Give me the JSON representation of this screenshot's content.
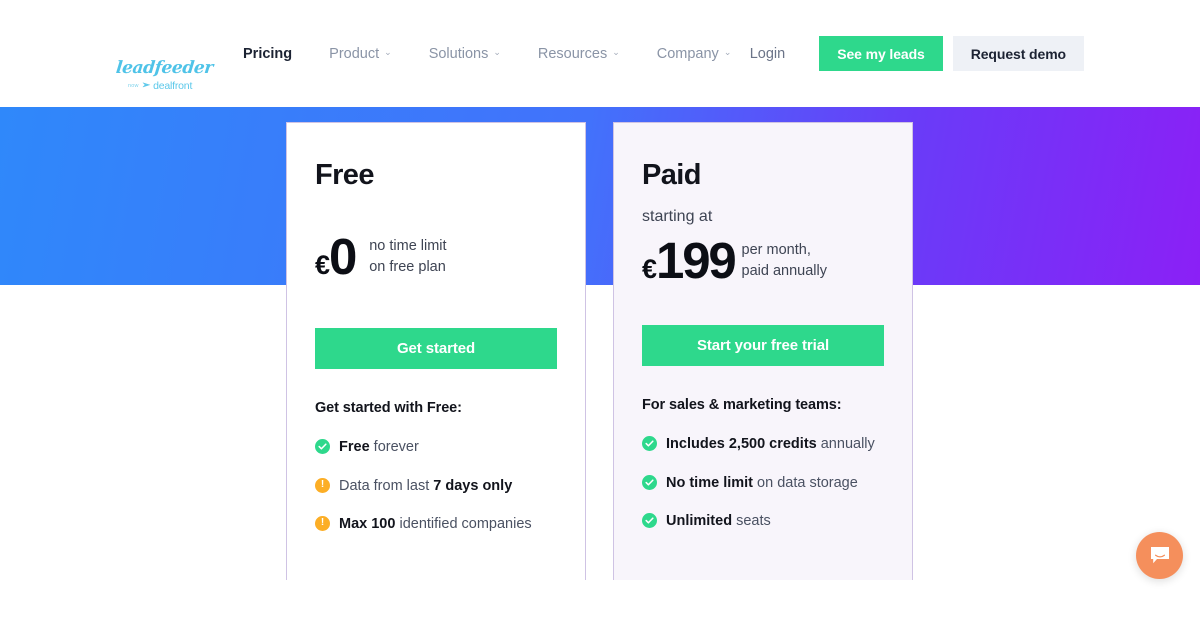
{
  "brand": {
    "logo_word": "leadfeeder",
    "logo_now": "now",
    "logo_mark": "➢",
    "logo_dealfront": "dealfront",
    "green": "#2ED88C",
    "orange": "#FCAE26",
    "gradient_from": "#2F88FA",
    "gradient_to": "#8B20F6",
    "chat_color": "#F58F5C"
  },
  "header": {
    "nav": [
      {
        "label": "Pricing",
        "has_caret": false,
        "active": true
      },
      {
        "label": "Product",
        "has_caret": true,
        "active": false
      },
      {
        "label": "Solutions",
        "has_caret": true,
        "active": false
      },
      {
        "label": "Resources",
        "has_caret": true,
        "active": false
      },
      {
        "label": "Company",
        "has_caret": true,
        "active": false
      }
    ],
    "login_label": "Login",
    "cta_primary": "See my leads",
    "cta_secondary": "Request demo",
    "caret_glyph": "⌄"
  },
  "plans": [
    {
      "id": "free",
      "title": "Free",
      "starting_at": "",
      "currency": "€",
      "amount": "0",
      "note_line1": "no time limit",
      "note_line2": "on free plan",
      "cta": "Get started",
      "list_heading": "Get started with Free:",
      "features": [
        {
          "icon": "check-circle-icon",
          "bold": "Free",
          "rest": " forever",
          "bold_first": true
        },
        {
          "icon": "warning-circle-icon",
          "lead": "Data from last ",
          "bold": "7 days only",
          "bold_first": false
        },
        {
          "icon": "warning-circle-icon",
          "bold": "Max 100",
          "rest": " identified companies",
          "bold_first": true
        }
      ]
    },
    {
      "id": "paid",
      "title": "Paid",
      "starting_at": "starting at",
      "currency": "€",
      "amount": "199",
      "note_line1": "per month,",
      "note_line2": "paid annually",
      "cta": "Start your free trial",
      "list_heading": "For sales & marketing teams:",
      "features": [
        {
          "icon": "check-circle-icon",
          "bold": "Includes 2,500 credits",
          "rest": " annually",
          "bold_first": true
        },
        {
          "icon": "check-circle-icon",
          "bold": "No time limit",
          "rest": " on data storage",
          "bold_first": true
        },
        {
          "icon": "check-circle-icon",
          "bold": "Unlimited",
          "rest": " seats",
          "bold_first": true
        }
      ]
    }
  ],
  "chat": {
    "name": "chat-launcher",
    "warn_glyph": "!"
  }
}
